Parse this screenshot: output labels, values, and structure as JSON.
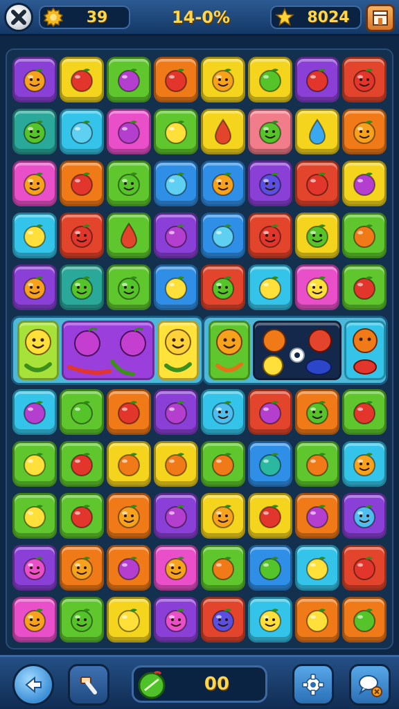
{
  "hud": {
    "coins": "39",
    "progress": "14-0%",
    "stars": "8024"
  },
  "bottom": {
    "moves_counter": "00"
  },
  "colors": {
    "purple": "#8a3fd6",
    "yellow": "#f4d41c",
    "green": "#5fc72d",
    "orange": "#f07a18",
    "red": "#e2452b",
    "blue": "#2f8fe6",
    "cyan": "#34c4ea",
    "pink": "#e84fc9",
    "teal": "#2aa89a",
    "salmon": "#f27d8a"
  },
  "grid": {
    "top_rows": [
      [
        "purple:orange-face",
        "yellow:red",
        "green:purple",
        "orange:red",
        "yellow:orange-face",
        "yellow:green",
        "purple:red",
        "red:red-face"
      ],
      [
        "teal:green-face",
        "cyan:cyan",
        "pink:purple",
        "green:yellow",
        "yellow:red-drop",
        "salmon:green-face",
        "yellow:blue-drop",
        "orange:orange-face"
      ],
      [
        "pink:orange-face",
        "orange:red",
        "green:green-face",
        "blue:cyan",
        "blue:orange-face",
        "purple:blue-face",
        "red:red",
        "yellow:purple"
      ],
      [
        "cyan:yellow",
        "red:red-face",
        "green:red-drop",
        "purple:purple",
        "blue:cyan",
        "red:red-face",
        "yellow:green-face",
        "green:orange"
      ],
      [
        "purple:orange-face",
        "teal:green-face",
        "green:green-face",
        "blue:yellow",
        "red:green-face",
        "cyan:yellow",
        "pink:yellow-face",
        "green:red"
      ]
    ],
    "bottom_rows": [
      [
        "cyan:purple",
        "green:green",
        "orange:red",
        "purple:purple",
        "cyan:cyan-face",
        "red:purple",
        "orange:green-face",
        "green:red"
      ],
      [
        "green:yellow",
        "green:red",
        "yellow:orange",
        "yellow:orange",
        "green:orange",
        "blue:teal",
        "green:orange",
        "cyan:orange-face"
      ],
      [
        "green:yellow",
        "green:red",
        "orange:orange-face",
        "purple:purple",
        "yellow:orange-face",
        "yellow:red",
        "orange:purple",
        "purple:cyan-face"
      ],
      [
        "purple:pink-face",
        "orange:orange-face",
        "orange:purple",
        "pink:orange-face",
        "green:orange",
        "blue:green",
        "cyan:yellow",
        "red:red"
      ],
      [
        "pink:orange-face",
        "green:green-face",
        "yellow:yellow",
        "purple:pink-face",
        "red:blue-face",
        "cyan:yellow-face",
        "orange:yellow",
        "orange:green"
      ]
    ]
  }
}
